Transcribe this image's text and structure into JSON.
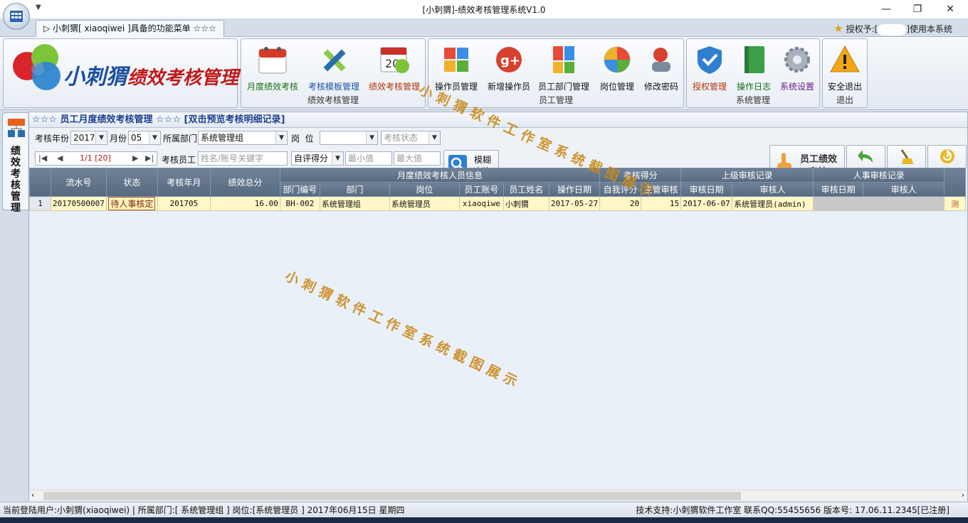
{
  "window": {
    "title": "[小刺猬]-绩效考核管理系统V1.0",
    "qa_arrow": "▼",
    "min": "—",
    "max": "❐",
    "close": "✕"
  },
  "menu_tab": {
    "label": "▷ 小刺猬[ xiaoqiwei ]具备的功能菜单 ☆☆☆"
  },
  "license": {
    "prefix": "授权予:[",
    "suffix": "]使用本系统"
  },
  "logo": {
    "text_a": "小刺猬",
    "text_b": "绩效考核管理"
  },
  "ribbon": {
    "groups": [
      {
        "label": "绩效考核管理",
        "buttons": [
          "月度绩效考核",
          "考核模板管理",
          "绩效考核管理"
        ]
      },
      {
        "label": "员工管理",
        "buttons": [
          "操作员管理",
          "新增操作员",
          "员工部门管理",
          "岗位管理",
          "修改密码"
        ]
      },
      {
        "label": "系统管理",
        "buttons": [
          "授权管理",
          "操作日志",
          "系统设置"
        ]
      },
      {
        "label": "退出",
        "buttons": [
          "安全退出"
        ]
      }
    ]
  },
  "sidebar": {
    "tab_label": "绩效考核管理"
  },
  "panel": {
    "title": "☆☆☆ 员工月度绩效考核管理 ☆☆☆ [双击预览考核明细记录]"
  },
  "filters": {
    "year_label": "考核年份",
    "year_value": "2017",
    "month_label": "月份",
    "month_value": "05",
    "dept_label": "所属部门",
    "dept_value": "系统管理组",
    "post_label": "岗  位",
    "post_value": "",
    "status_placeholder": "考核状态",
    "employee_label": "考核员工",
    "employee_placeholder": "姓名/账号关键字",
    "score_select": "自评得分",
    "min_placeholder": "最小值",
    "max_placeholder": "最大值",
    "search_label_1": "模糊",
    "search_label_2": "查询",
    "pager": {
      "first": "|◀",
      "prev": "◀",
      "info": "1/1 [20]",
      "next": "▶",
      "last": "▶|"
    }
  },
  "actions": {
    "review_1": "员工绩效",
    "review_2": "审核",
    "undo": "撤 回",
    "delete": "删 除",
    "refresh": "刷 新"
  },
  "grid": {
    "group_headers": [
      "月度绩效考核人员信息",
      "考核得分",
      "上级审核记录",
      "人事审核记录"
    ],
    "columns_top": [
      "流水号",
      "状态",
      "考核年月",
      "绩效总分"
    ],
    "columns_sub": [
      "部门编号",
      "部门",
      "岗位",
      "员工账号",
      "员工姓名",
      "操作日期",
      "自我评分",
      "主管审核",
      "审核日期",
      "审核人",
      "审核日期",
      "审核人"
    ],
    "rows": [
      {
        "num": "1",
        "serial": "20170500007",
        "status": "待人事核定",
        "ym": "201705",
        "total": "16.00",
        "dept_no": "BH-002",
        "dept": "系统管理组",
        "post": "系统管理员",
        "account": "xiaoqiwe",
        "name": "小刺猬",
        "op_date": "2017-05-27",
        "self": "20",
        "mgr": "15",
        "audit_date": "2017-06-07",
        "auditor": "系统管理员(admin)",
        "hr_date": "",
        "hr_auditor": "",
        "extra": "测"
      }
    ]
  },
  "watermark": {
    "text": "小刺猬软件工作室系统截图展示"
  },
  "status": {
    "left": "当前登陆用户:小刺猬(xiaoqiwei) | 所属部门:[ 系统管理组 ] 岗位:[系统管理员 ] 2017年06月15日 星期四",
    "right": "技术支持:小刺猬软件工作室 联系QQ:55455656 版本号: 17.06.11.2345[已注册]"
  },
  "colors": {
    "ribbon_accent": "#1c4fa0",
    "row_highlight": "#fff7c8",
    "header": "#5f7289",
    "watermark": "#c98a1a"
  }
}
